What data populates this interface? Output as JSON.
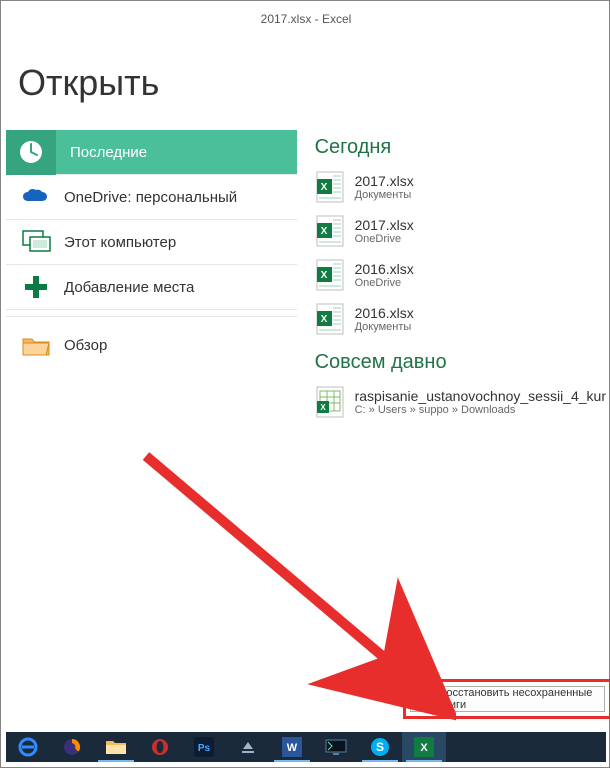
{
  "window_title": "2017.xlsx - Excel",
  "page_heading": "Открыть",
  "sidebar": {
    "items": [
      {
        "label": "Последние",
        "icon": "clock-icon"
      },
      {
        "label": "OneDrive: персональный",
        "icon": "onedrive-icon"
      },
      {
        "label": "Этот компьютер",
        "icon": "computer-icon"
      },
      {
        "label": "Добавление места",
        "icon": "plus-icon"
      },
      {
        "label": "Обзор",
        "icon": "folder-icon"
      }
    ]
  },
  "sections": [
    {
      "title": "Сегодня",
      "files": [
        {
          "name": "2017.xlsx",
          "location": "Документы",
          "type": "xlsx"
        },
        {
          "name": "2017.xlsx",
          "location": "OneDrive",
          "type": "xlsx"
        },
        {
          "name": "2016.xlsx",
          "location": "OneDrive",
          "type": "xlsx"
        },
        {
          "name": "2016.xlsx",
          "location": "Документы",
          "type": "xlsx"
        }
      ]
    },
    {
      "title": "Совсем давно",
      "files": [
        {
          "name": "raspisanie_ustanovochnoy_sessii_4_kur",
          "location": "C: » Users » suppo » Downloads",
          "type": "xls"
        }
      ]
    }
  ],
  "recover_button": "Восстановить несохраненные книги",
  "taskbar": [
    "edge-icon",
    "firefox-icon",
    "explorer-icon",
    "opera-icon",
    "photoshop-icon",
    "tray-icon",
    "word-icon",
    "monitor-icon",
    "skype-icon",
    "excel-icon"
  ],
  "colors": {
    "accent": "#217346",
    "tab_active": "#4bbf9a",
    "highlight": "#e82e2c"
  }
}
